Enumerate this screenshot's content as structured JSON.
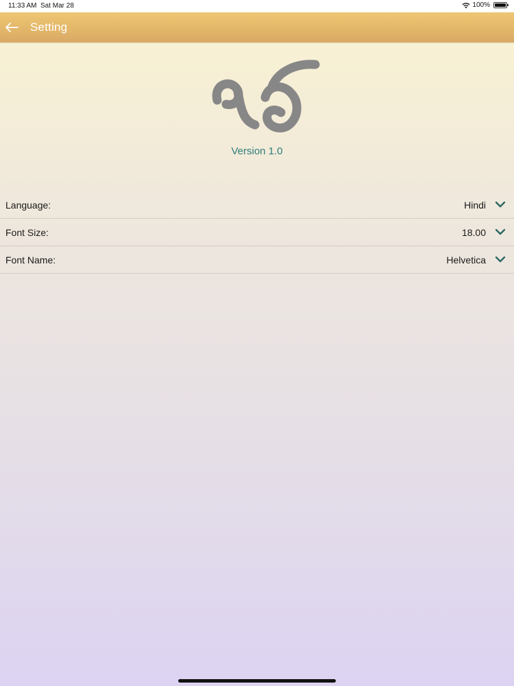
{
  "status_bar": {
    "time": "11:33 AM",
    "date": "Sat Mar 28",
    "battery": "100%"
  },
  "header": {
    "title": "Setting",
    "back_icon": "arrow-left-icon"
  },
  "about": {
    "logo_icon": "ik-onkar-logo",
    "version": "Version 1.0"
  },
  "settings": [
    {
      "label": "Language:",
      "value": "Hindi"
    },
    {
      "label": "Font Size:",
      "value": "18.00"
    },
    {
      "label": "Font Name:",
      "value": "Helvetica"
    }
  ],
  "colors": {
    "nav_bar": "#e3b769",
    "accent": "#2f7d7a",
    "logo": "#878787"
  }
}
